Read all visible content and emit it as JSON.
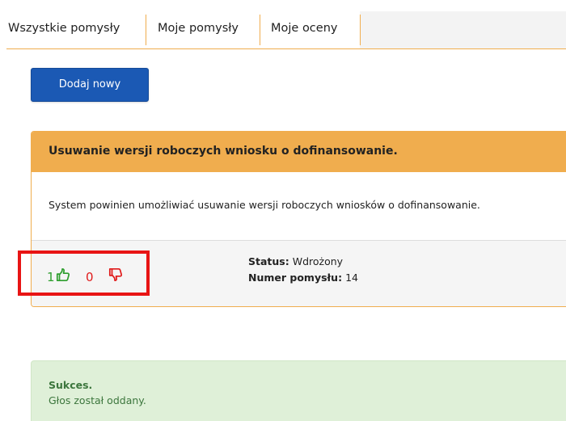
{
  "tabs": [
    {
      "label": "Wszystkie pomysły",
      "active": true
    },
    {
      "label": "Moje pomysły",
      "active": false
    },
    {
      "label": "Moje oceny",
      "active": false
    }
  ],
  "actions": {
    "add_new_label": "Dodaj nowy"
  },
  "idea": {
    "title": "Usuwanie wersji roboczych wniosku o dofinansowanie.",
    "description": "System powinien umożliwiać usuwanie wersji roboczych wniosków o dofinansowanie.",
    "votes_up": "1",
    "votes_down": "0",
    "status_label": "Status:",
    "status_value": "Wdrożony",
    "number_label": "Numer pomysłu:",
    "number_value": "14"
  },
  "alert": {
    "title": "Sukces.",
    "message": "Głos został oddany."
  },
  "icons": {
    "upvote": "thumbs-up-icon",
    "downvote": "thumbs-down-icon"
  },
  "colors": {
    "accent": "#f0ad4e",
    "primary": "#1b59b4",
    "upvote": "#2e9e2e",
    "downvote": "#e01b1b",
    "highlight": "#e81414",
    "success_bg": "#dff0d8",
    "success_text": "#3c763d"
  }
}
